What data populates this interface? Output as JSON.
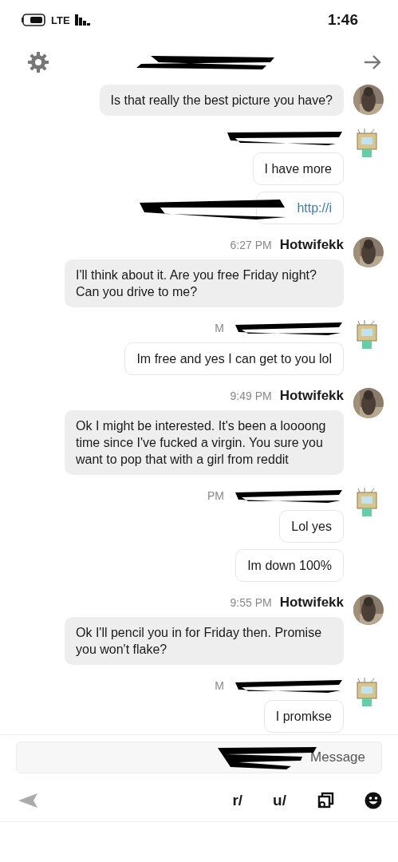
{
  "status_bar": {
    "time": "1:46",
    "network": "LTE"
  },
  "messages": [
    {
      "kind": "their",
      "bubbles": [
        {
          "kind": "text",
          "text": "Is that really the best picture you have?"
        }
      ]
    },
    {
      "kind": "mine",
      "bubbles": [
        {
          "kind": "text",
          "text": "I have more"
        },
        {
          "kind": "link",
          "text": "http://i"
        }
      ]
    },
    {
      "kind": "their",
      "author": "Hotwifekk",
      "time": "6:27 PM",
      "bubbles": [
        {
          "kind": "text",
          "text": "I'll think about it. Are you free Friday night? Can you drive to me?"
        }
      ]
    },
    {
      "kind": "mine",
      "time": "M",
      "bubbles": [
        {
          "kind": "text",
          "text": "Im free and yes I can get to you lol"
        }
      ]
    },
    {
      "kind": "their",
      "author": "Hotwifekk",
      "time": "9:49 PM",
      "bubbles": [
        {
          "kind": "text",
          "text": "Ok I might be interested. It's been a loooong time since I've fucked a virgin. You sure you want to pop that with a girl from reddit"
        }
      ]
    },
    {
      "kind": "mine",
      "time": "PM",
      "bubbles": [
        {
          "kind": "text",
          "text": "Lol yes"
        },
        {
          "kind": "text",
          "text": "Im down 100%"
        }
      ]
    },
    {
      "kind": "their",
      "author": "Hotwifekk",
      "time": "9:55 PM",
      "bubbles": [
        {
          "kind": "text",
          "text": "Ok I'll pencil you in for Friday then. Promise you won't flake?"
        }
      ]
    },
    {
      "kind": "mine",
      "time": "M",
      "bubbles": [
        {
          "kind": "text",
          "text": "I promkse"
        }
      ]
    }
  ],
  "composer": {
    "placeholder": "Message"
  },
  "toolbar": {
    "user_tag": "u/",
    "subreddit_tag": "r/"
  }
}
